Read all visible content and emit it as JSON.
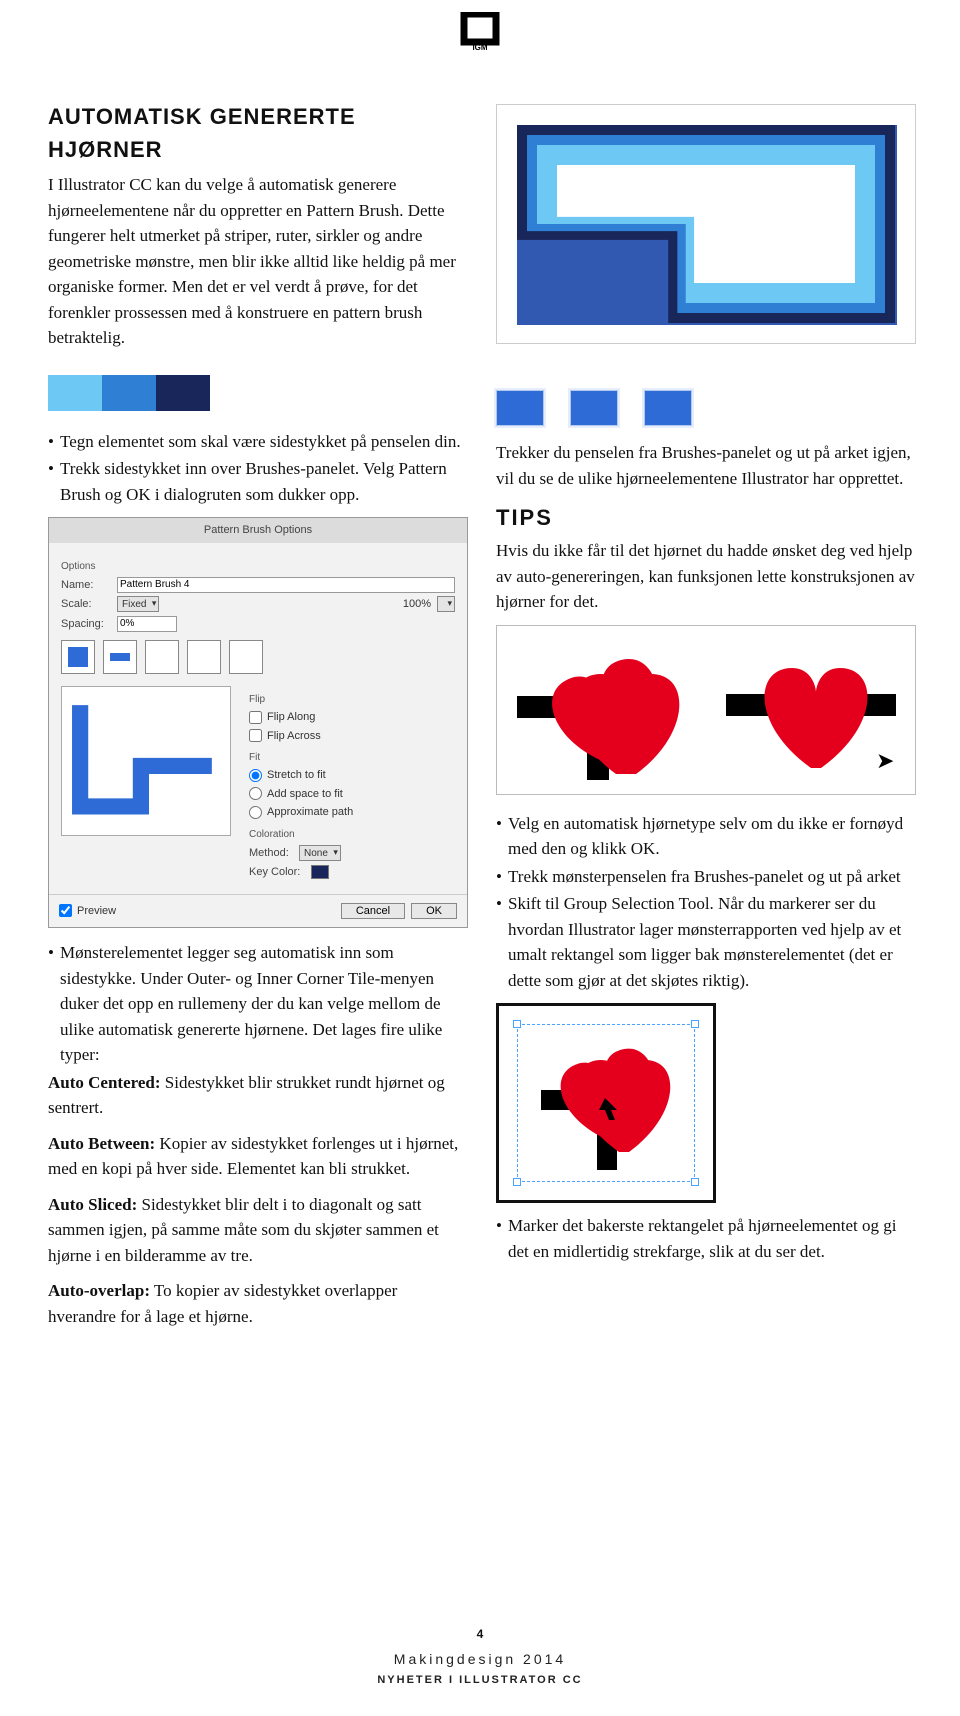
{
  "logo_text": "IGM",
  "h1": "AUTOMATISK GENERERTE HJØRNER",
  "intro": "I Illustrator CC kan du velge å automatisk generere hjørneelementene når du oppretter en Pattern Brush. Dette fungerer helt utmerket på striper, ruter, sirkler og andre geometriske mønstre, men blir ikke alltid like heldig på mer organiske former. Men det er vel verdt å prøve, for det forenkler prossessen med å konstruere en pattern brush betraktelig.",
  "bullets_left_top": [
    "Tegn elementet som skal være sidestykket på penselen din.",
    "Trekk sidestykket inn over Brushes-panelet. Velg Pattern Brush og OK i dialogruten som dukker opp."
  ],
  "panel": {
    "title": "Pattern Brush Options",
    "opts_label": "Options",
    "name_label": "Name:",
    "name_value": "Pattern Brush 4",
    "scale_label": "Scale:",
    "scale_value": "Fixed",
    "scale_pct": "100%",
    "spacing_label": "Spacing:",
    "spacing_value": "0%",
    "flip_label": "Flip",
    "flip_along": "Flip Along",
    "flip_across": "Flip Across",
    "fit_label": "Fit",
    "fit_stretch": "Stretch to fit",
    "fit_add": "Add space to fit",
    "fit_approx": "Approximate path",
    "coloration": "Coloration",
    "method_label": "Method:",
    "method_value": "None",
    "keycolor": "Key Color:",
    "preview": "Preview",
    "cancel": "Cancel",
    "ok": "OK"
  },
  "left_bottom_para_pre": "Mønsterelementet legger seg automatisk inn som sidestykke. Under Outer- og Inner Corner Tile-menyen duker det opp en rullemeny der du kan velge mellom de ulike automatisk genererte hjørnene. Det lages fire ulike typer:",
  "left_bottom_bullet": "Mønsterelementet legger seg automatisk inn som sidestykke. Under Outer- og Inner Corner Tile-menyen duker det opp en rullemeny der du kan velge mellom de ulike automatisk genererte hjørnene. Det lages fire ulike typer:",
  "auto_centered_label": "Auto Centered:",
  "auto_centered_text": " Sidestykket blir strukket rundt hjørnet og sentrert.",
  "auto_between_label": "Auto Between:",
  "auto_between_text": " Kopier av sidestykket forlenges ut i hjørnet, med en kopi på hver side. Elementet kan bli strukket.",
  "auto_sliced_label": "Auto Sliced:",
  "auto_sliced_text": " Sidestykket blir delt i to diagonalt og satt sammen igjen, på samme måte som du skjøter sammen et hjørne i en bilderamme av tre.",
  "auto_overlap_label": "Auto-overlap:",
  "auto_overlap_text": " To kopier av sidestykket overlapper hverandre for å lage et hjørne.",
  "right_trekker": "Trekker du penselen fra Brushes-panelet og ut på arket igjen, vil du se de ulike hjørneelementene Illustrator har opprettet.",
  "tips_h": "TIPS",
  "tips_text": "Hvis du ikke får til det hjørnet du hadde ønsket deg ved hjelp av auto-genereringen, kan funksjonen lette konstruksjonen av hjørner for det.",
  "right_bullets": [
    "Velg en automatisk hjørnetype selv om du ikke er fornøyd med den og klikk OK.",
    "Trekk mønsterpenselen fra Brushes-panelet og ut på arket",
    "Skift til Group Selection Tool. Når du markerer ser du hvordan Illustrator lager mønsterrapporten ved hjelp av et umalt rektangel som ligger bak mønsterelementet (det er dette som gjør at det skjøtes riktig)."
  ],
  "right_last_bullet": "Marker det bakerste rektangelet på hjørneelementet og gi det en midlertidig strekfarge, slik at du ser det.",
  "footer": {
    "page": "4",
    "line1": "Makingdesign 2014",
    "line2": "NYHETER I ILLUSTRATOR CC"
  }
}
